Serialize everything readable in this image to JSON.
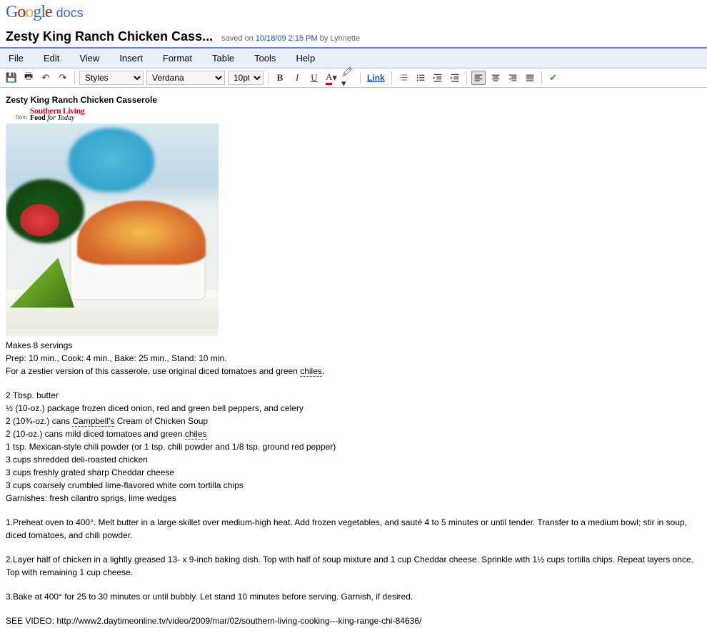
{
  "logo": {
    "google": "Google",
    "docs": "docs"
  },
  "header": {
    "title": "Zesty King Ranch Chicken Cass...",
    "saved_prefix": "saved on ",
    "saved_date": "10/18/09 2:15 PM",
    "saved_by": " by Lynnette"
  },
  "menu": [
    "File",
    "Edit",
    "View",
    "Insert",
    "Format",
    "Table",
    "Tools",
    "Help"
  ],
  "toolbar": {
    "style_select": "Styles",
    "font_select": "Verdana",
    "size_select": "10pt",
    "link": "Link"
  },
  "doc": {
    "title": "Zesty King Ranch Chicken Casserole",
    "from": "from",
    "brand_top": "Southern Living",
    "brand_bot_bold": "Food",
    "brand_bot_rest": " for Today",
    "servings": "Makes 8 servings",
    "times": "Prep: 10 min., Cook: 4 min., Bake: 25 min., Stand: 10 min.",
    "note_a": "For a zestier version of this casserole, use original diced tomatoes and green ",
    "note_b": "chiles",
    "note_c": ".",
    "ing1": "2 Tbsp. butter",
    "ing2": "½ (10-oz.) package frozen diced onion, red and green bell peppers, and celery",
    "ing3a": "2 (10¾-oz.) cans ",
    "ing3b": "Campbell's",
    "ing3c": " Cream of Chicken Soup",
    "ing4a": "2 (10-oz.) cans mild diced tomatoes and green ",
    "ing4b": "chiles",
    "ing5": "1 tsp. Mexican-style chili powder (or 1 tsp. chili powder and 1/8 tsp. ground red pepper)",
    "ing6": "3 cups shredded deli-roasted chicken",
    "ing7": "3 cups freshly grated sharp Cheddar cheese",
    "ing8": "3 cups coarsely crumbled lime-flavored white corn tortilla chips",
    "ing9": "Garnishes: fresh cilantro sprigs, lime wedges",
    "step1": "1.Preheat oven to 400°. Melt butter in a large skillet over medium-high heat. Add frozen vegetables, and sauté 4 to 5 minutes or until tender. Transfer to a medium bowl; stir in soup, diced tomatoes, and chili powder.",
    "step2": "2.Layer half of chicken in a lightly greased 13- x 9-inch baking dish. Top with half of soup mixture and 1 cup Cheddar cheese. Sprinkle with 1½ cups tortilla chips. Repeat layers once. Top with remaining 1 cup cheese.",
    "step3": "3.Bake at 400° for 25 to 30 minutes or until bubbly. Let stand 10 minutes before serving. Garnish, if desired.",
    "video": "SEE VIDEO: http://www2.daytimeonline.tv/video/2009/mar/02/southern-living-cooking---king-range-chi-84636/"
  }
}
